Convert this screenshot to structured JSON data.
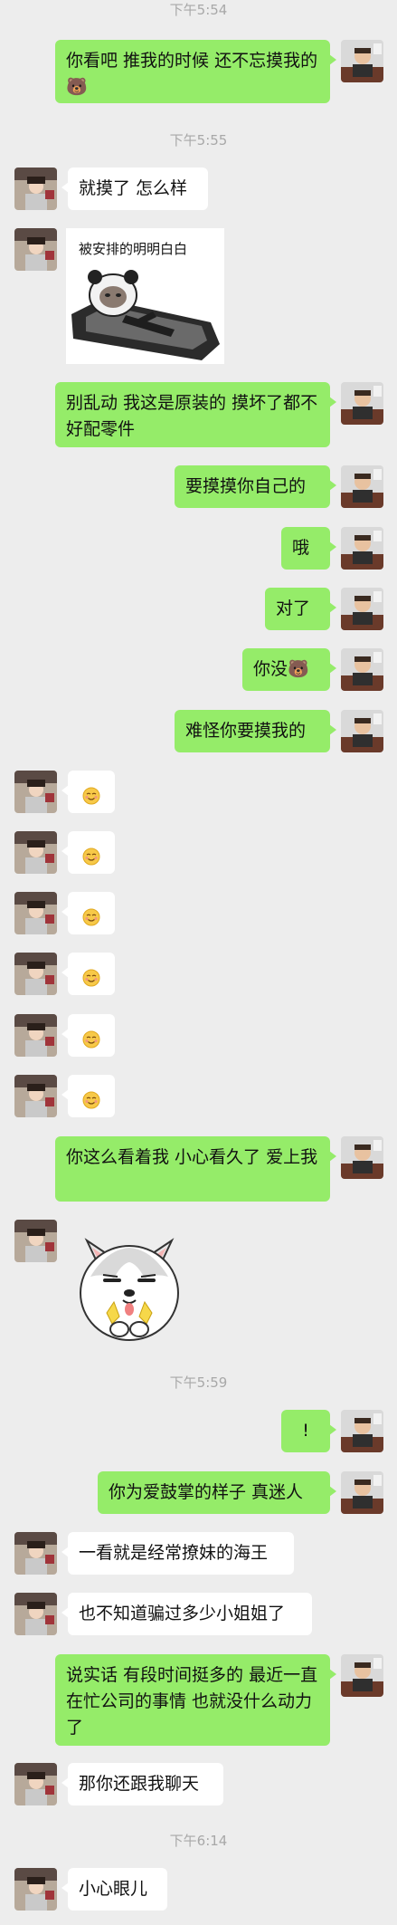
{
  "app": "WeChat",
  "colors": {
    "outgoing_bubble": "#95ec69",
    "incoming_bubble": "#ffffff",
    "background": "#ededed",
    "timestamp_text": "#a8a8a8"
  },
  "timestamps": [
    "下午5:54",
    "下午5:55",
    "下午5:59",
    "下午6:14"
  ],
  "messages": [
    {
      "from": "me",
      "type": "text",
      "text": "你看吧 推我的时候 还不忘摸我的🐻"
    },
    {
      "from": "them",
      "type": "text",
      "text": "就摸了 怎么样"
    },
    {
      "from": "them",
      "type": "sticker",
      "icon": "panda-meme-coffin-sticker",
      "caption": "被安排的明明白白"
    },
    {
      "from": "me",
      "type": "text",
      "text": "别乱动 我这是原装的 摸坏了都不好配零件"
    },
    {
      "from": "me",
      "type": "text",
      "text": "要摸摸你自己的"
    },
    {
      "from": "me",
      "type": "text",
      "text": "哦"
    },
    {
      "from": "me",
      "type": "text",
      "text": "对了"
    },
    {
      "from": "me",
      "type": "text",
      "text": "你没🐻"
    },
    {
      "from": "me",
      "type": "text",
      "text": "难怪你要摸我的"
    },
    {
      "from": "them",
      "type": "emoji",
      "icon": "shy-smile-emoji"
    },
    {
      "from": "them",
      "type": "emoji",
      "icon": "shy-smile-emoji"
    },
    {
      "from": "them",
      "type": "emoji",
      "icon": "shy-smile-emoji"
    },
    {
      "from": "them",
      "type": "emoji",
      "icon": "shy-smile-emoji"
    },
    {
      "from": "them",
      "type": "emoji",
      "icon": "shy-smile-emoji"
    },
    {
      "from": "them",
      "type": "emoji",
      "icon": "shy-smile-emoji"
    },
    {
      "from": "me",
      "type": "text",
      "text": "你这么看着我 小心看久了 爱上我"
    },
    {
      "from": "them",
      "type": "sticker",
      "icon": "husky-clapping-sticker"
    },
    {
      "from": "me",
      "type": "text",
      "text": "!"
    },
    {
      "from": "me",
      "type": "text",
      "text": "你为爱鼓掌的样子 真迷人"
    },
    {
      "from": "them",
      "type": "text",
      "text": "一看就是经常撩妹的海王"
    },
    {
      "from": "them",
      "type": "text",
      "text": "也不知道骗过多少小姐姐了"
    },
    {
      "from": "me",
      "type": "text",
      "text": "说实话 有段时间挺多的 最近一直在忙公司的事情 也就没什么动力了"
    },
    {
      "from": "them",
      "type": "text",
      "text": "那你还跟我聊天"
    },
    {
      "from": "them",
      "type": "text",
      "text": "小心眼儿"
    }
  ]
}
